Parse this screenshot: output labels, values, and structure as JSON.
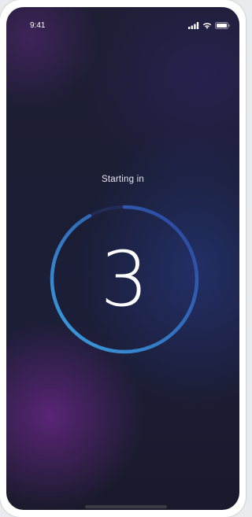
{
  "status_bar": {
    "time": "9:41",
    "icons": [
      "cellular-signal-icon",
      "wifi-icon",
      "battery-icon"
    ]
  },
  "countdown": {
    "label": "Starting in",
    "value": "3",
    "progress": 0.92,
    "colors": {
      "ring_start": "#3aa0e0",
      "ring_end": "#2c3f9a",
      "track": "#2a3470",
      "text": "#ffffff"
    }
  }
}
